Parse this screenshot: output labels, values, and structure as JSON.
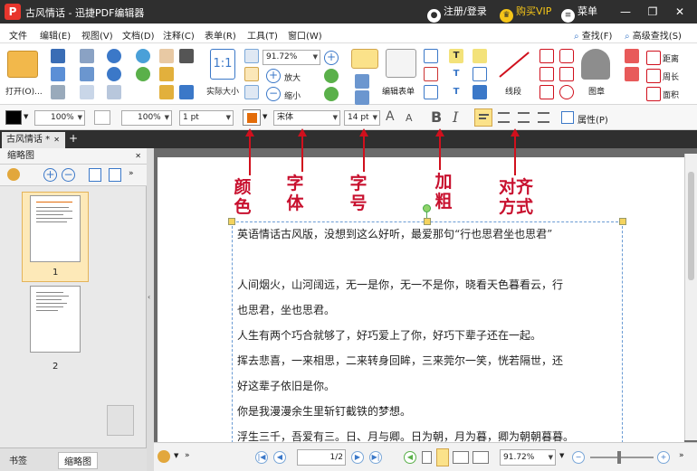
{
  "titlebar": {
    "logo": "P",
    "title": "古风情话 - 迅捷PDF编辑器",
    "login": "注册/登录",
    "vip": "购买VIP",
    "menu": "菜单",
    "minimize": "—",
    "restore": "❐",
    "close": "✕"
  },
  "menubar": {
    "items": [
      "文件",
      "编辑(E)",
      "视图(V)",
      "文档(D)",
      "注释(C)",
      "表单(R)",
      "工具(T)",
      "窗口(W)"
    ],
    "find": "查找(F)",
    "advanced_find": "高级查找(S)"
  },
  "ribbon": {
    "open": "打开(O)...",
    "actual_size": "实际大小",
    "zoom_value": "91.72%",
    "zoom_in": "放大",
    "zoom_out": "缩小",
    "edit_form": "编辑表单",
    "line": "线段",
    "stamp": "图章",
    "distance": "距离",
    "perimeter": "周长",
    "area": "面积"
  },
  "formatbar": {
    "opacity1": "100%",
    "opacity2": "100%",
    "line_width": "1 pt",
    "font_name": "宋体",
    "font_size": "14 pt",
    "bold": "B",
    "italic": "I",
    "properties": "属性(P)"
  },
  "tabs": {
    "doc_tab": "古风情话 *",
    "add": "+"
  },
  "leftpanel": {
    "title": "缩略图",
    "page1": "1",
    "page2": "2",
    "bookmarks_tab": "书签",
    "thumbnails_tab": "缩略图"
  },
  "annotations": {
    "color": "颜色",
    "font": "字体",
    "size": "字号",
    "bold": "加粗",
    "align": "对齐方式"
  },
  "document": {
    "lines": [
      "英语情话古风版，没想到这么好听，最爱那句“行也思君坐也思君”",
      "人间烟火，山河阔远，无一是你，无一不是你，晓看天色暮看云，行",
      "也思君，坐也思君。",
      "人生有两个巧合就够了，好巧爱上了你，好巧下辈子还在一起。",
      "挥去悲喜，一来相思，二来转身回眸，三来莞尔一笑，恍若隔世，还",
      "好这辈子依旧是你。",
      "你是我漫漫余生里斩钉截铁的梦想。",
      "浮生三千，吾爱有三。日、月与卿。日为朝，月为暮，卿为朝朝暮暮。"
    ]
  },
  "statusbar": {
    "page_field": "1",
    "page_total": "/2",
    "zoom": "91.72%"
  },
  "colors": {
    "accent_red": "#d0101d",
    "title_bg": "#2f2f2f",
    "format_color": "#e36c09"
  }
}
